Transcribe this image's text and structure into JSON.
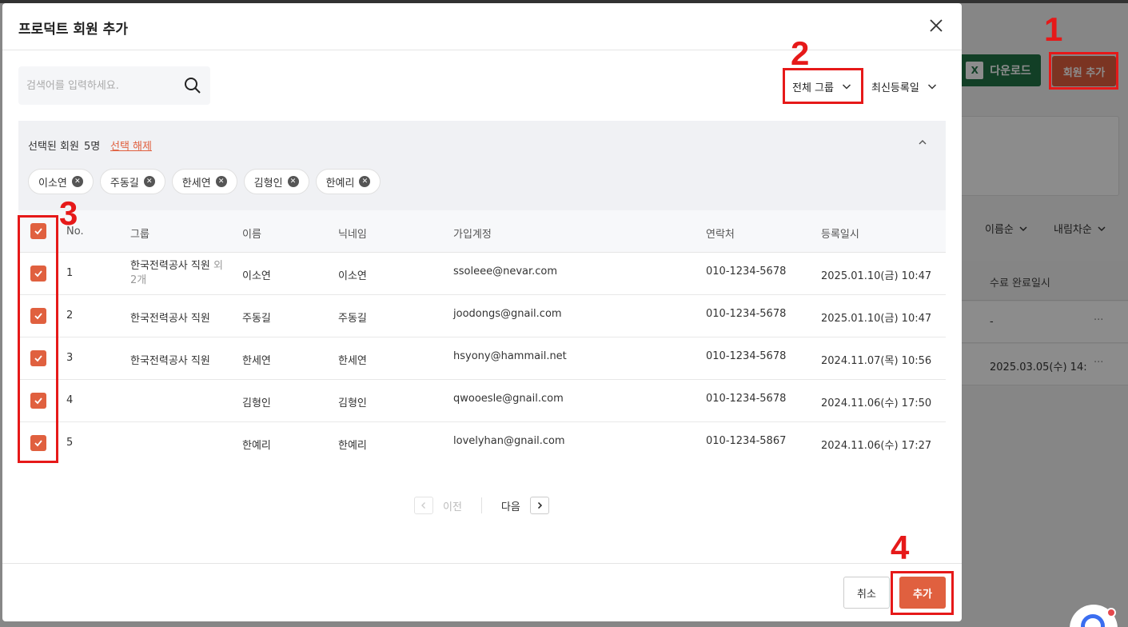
{
  "background": {
    "download_label": "다운로드",
    "excel_icon_letter": "X",
    "add_member_label": "회원 추가",
    "sort_name": "이름순",
    "sort_desc": "내림차순",
    "col_complete": "수료 완료일시",
    "rows": [
      {
        "value": "-",
        "more": "···"
      },
      {
        "value": "2025.03.05(수) 14:",
        "more": "···"
      }
    ]
  },
  "modal": {
    "title": "프로덕트 회원 추가",
    "search": {
      "placeholder": "검색어를 입력하세요."
    },
    "group_filter": "전체 그룹",
    "sort_filter": "최신등록일",
    "selected": {
      "label": "선택된 회원",
      "count": "5명",
      "clear": "선택 해제",
      "chips": [
        "이소연",
        "주동길",
        "한세연",
        "김형인",
        "한예리"
      ]
    },
    "table": {
      "headers": {
        "no": "No.",
        "group": "그룹",
        "name": "이름",
        "nickname": "닉네임",
        "account": "가입계정",
        "contact": "연락처",
        "registered": "등록일시"
      },
      "rows": [
        {
          "no": "1",
          "group": "한국전력공사 직원",
          "group_extra": "외 2개",
          "name": "이소연",
          "nickname": "이소연",
          "account": "ssoleee@nevar.com",
          "contact": "010-1234-5678",
          "registered": "2025.01.10(금) 10:47",
          "checked": true
        },
        {
          "no": "2",
          "group": "한국전력공사 직원",
          "group_extra": "",
          "name": "주동길",
          "nickname": "주동길",
          "account": "joodongs@gnail.com",
          "contact": "010-1234-5678",
          "registered": "2025.01.10(금) 10:47",
          "checked": true
        },
        {
          "no": "3",
          "group": "한국전력공사 직원",
          "group_extra": "",
          "name": "한세연",
          "nickname": "한세연",
          "account": "hsyony@hammail.net",
          "contact": "010-1234-5678",
          "registered": "2024.11.07(목) 10:56",
          "checked": true
        },
        {
          "no": "4",
          "group": "",
          "group_extra": "",
          "name": "김형인",
          "nickname": "김형인",
          "account": "qwooesle@gnail.com",
          "contact": "010-1234-5678",
          "registered": "2024.11.06(수) 17:50",
          "checked": true
        },
        {
          "no": "5",
          "group": "",
          "group_extra": "",
          "name": "한예리",
          "nickname": "한예리",
          "account": "lovelyhan@gnail.com",
          "contact": "010-1234-5867",
          "registered": "2024.11.06(수) 17:27",
          "checked": true
        }
      ]
    },
    "pagination": {
      "prev": "이전",
      "next": "다음"
    },
    "buttons": {
      "cancel": "취소",
      "add": "추가"
    }
  },
  "annotations": [
    "1",
    "2",
    "3",
    "4"
  ],
  "colors": {
    "accent": "#e0603f",
    "annotation": "#e61919",
    "excel": "#217346"
  }
}
